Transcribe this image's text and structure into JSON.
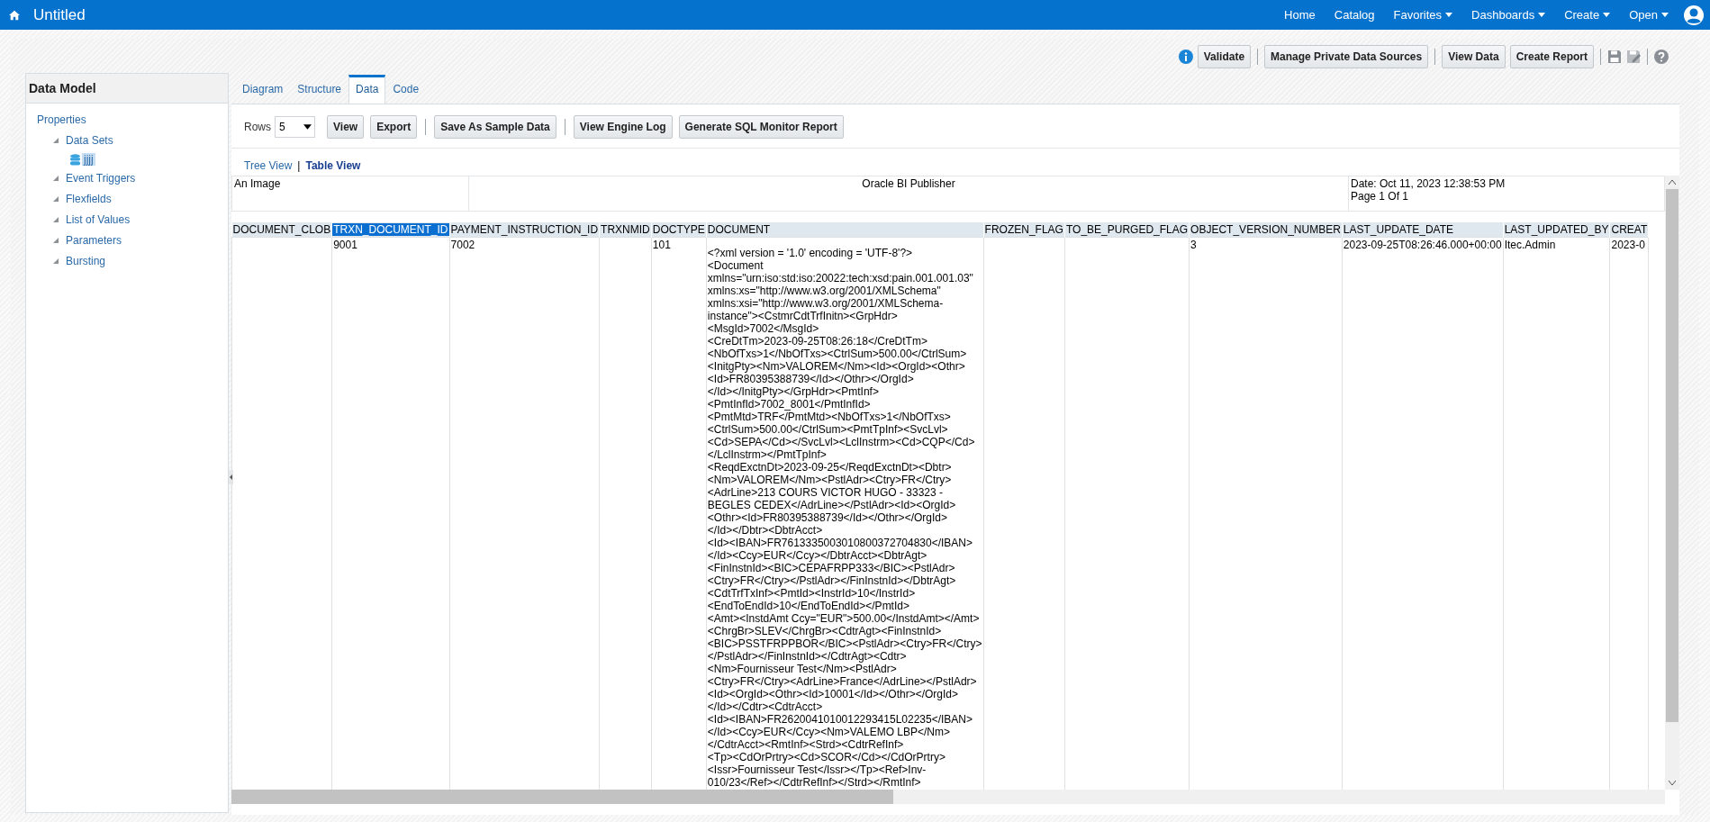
{
  "header": {
    "title": "Untitled",
    "nav": [
      {
        "label": "Home",
        "dropdown": false
      },
      {
        "label": "Catalog",
        "dropdown": false
      },
      {
        "label": "Favorites",
        "dropdown": true
      },
      {
        "label": "Dashboards",
        "dropdown": true
      },
      {
        "label": "Create",
        "dropdown": true
      },
      {
        "label": "Open",
        "dropdown": true
      }
    ]
  },
  "toolbar": {
    "buttons": [
      {
        "label": "Validate",
        "separator_after": true
      },
      {
        "label": "Manage Private Data Sources",
        "separator_after": true
      },
      {
        "label": "View Data",
        "separator_after": false
      },
      {
        "label": "Create Report",
        "separator_after": true
      }
    ]
  },
  "data_model": {
    "title": "Data Model",
    "tree": [
      {
        "label": "Properties",
        "children": [
          {
            "label": "Data Sets",
            "expanded": true,
            "children": [
              {
                "label": "jjjj",
                "selected": true
              }
            ]
          },
          {
            "label": "Event Triggers",
            "expanded": true
          },
          {
            "label": "Flexfields",
            "expanded": true
          },
          {
            "label": "List of Values",
            "expanded": true
          },
          {
            "label": "Parameters",
            "expanded": true
          },
          {
            "label": "Bursting",
            "expanded": true
          }
        ]
      }
    ]
  },
  "tabs": [
    {
      "label": "Diagram",
      "selected": false
    },
    {
      "label": "Structure",
      "selected": false
    },
    {
      "label": "Data",
      "selected": true
    },
    {
      "label": "Code",
      "selected": false
    }
  ],
  "rows_control": {
    "label": "Rows",
    "value": "5"
  },
  "data_buttons": [
    {
      "label": "View",
      "separator_after": false
    },
    {
      "label": "Export",
      "separator_after": true
    },
    {
      "label": "Save As Sample Data",
      "separator_after": true
    },
    {
      "label": "View Engine Log",
      "separator_after": false
    },
    {
      "label": "Generate SQL Monitor Report",
      "separator_after": false
    }
  ],
  "view_links": [
    {
      "label": "Tree View",
      "selected": false
    },
    {
      "label": "Table View",
      "selected": true
    }
  ],
  "view_separator": "|",
  "report_header": {
    "left": "An Image",
    "center": "Oracle BI Publisher",
    "date": "Date: Oct 11, 2023 12:38:53 PM",
    "page": "Page 1 Of 1"
  },
  "table": {
    "columns": [
      {
        "label": "DOCUMENT_CLOB",
        "selected": false
      },
      {
        "label": "TRXN_DOCUMENT_ID",
        "selected": true
      },
      {
        "label": "PAYMENT_INSTRUCTION_ID",
        "selected": false
      },
      {
        "label": "TRXNMID",
        "selected": false
      },
      {
        "label": "DOCTYPE",
        "selected": false
      },
      {
        "label": "DOCUMENT",
        "selected": false
      },
      {
        "label": "FROZEN_FLAG",
        "selected": false
      },
      {
        "label": "TO_BE_PURGED_FLAG",
        "selected": false
      },
      {
        "label": "OBJECT_VERSION_NUMBER",
        "selected": false
      },
      {
        "label": "LAST_UPDATE_DATE",
        "selected": false
      },
      {
        "label": "LAST_UPDATED_BY",
        "selected": false
      },
      {
        "label": "CREAT",
        "selected": false
      }
    ],
    "rows": [
      [
        "",
        "9001",
        "7002",
        "",
        "101",
        "<?xml version = '1.0' encoding = 'UTF-8'?>\n<Document\nxmlns=\"urn:iso:std:iso:20022:tech:xsd:pain.001.001.03\"\nxmlns:xs=\"http://www.w3.org/2001/XMLSchema\"\nxmlns:xsi=\"http://www.w3.org/2001/XMLSchema-\ninstance\"><CstmrCdtTrfInitn><GrpHdr>\n<MsgId>7002</MsgId>\n<CreDtTm>2023-09-25T08:26:18</CreDtTm>\n<NbOfTxs>1</NbOfTxs><CtrlSum>500.00</CtrlSum>\n<InitgPty><Nm>VALOREM</Nm><Id><OrgId><Othr>\n<Id>FR80395388739</Id></Othr></OrgId>\n</Id></InitgPty></GrpHdr><PmtInf>\n<PmtInfId>7002_8001</PmtInfId>\n<PmtMtd>TRF</PmtMtd><NbOfTxs>1</NbOfTxs>\n<CtrlSum>500.00</CtrlSum><PmtTpInf><SvcLvl>\n<Cd>SEPA</Cd></SvcLvl><LclInstrm><Cd>CQP</Cd>\n</LclInstrm></PmtTpInf>\n<ReqdExctnDt>2023-09-25</ReqdExctnDt><Dbtr>\n<Nm>VALOREM</Nm><PstlAdr><Ctry>FR</Ctry>\n<AdrLine>213 COURS VICTOR HUGO - 33323 -\nBEGLES CEDEX</AdrLine></PstlAdr><Id><OrgId>\n<Othr><Id>FR80395388739</Id></Othr></OrgId>\n</Id></Dbtr><DbtrAcct>\n<Id><IBAN>FR7613335003010800372704830</IBAN>\n</Id><Ccy>EUR</Ccy></DbtrAcct><DbtrAgt>\n<FinInstnId><BIC>CEPAFRPP333</BIC><PstlAdr>\n<Ctry>FR</Ctry></PstlAdr></FinInstnId></DbtrAgt>\n<CdtTrfTxInf><PmtId><InstrId>10</InstrId>\n<EndToEndId>10</EndToEndId></PmtId>\n<Amt><InstdAmt Ccy=\"EUR\">500.00</InstdAmt></Amt>\n<ChrgBr>SLEV</ChrgBr><CdtrAgt><FinInstnId>\n<BIC>PSSTFRPPBOR</BIC><PstlAdr><Ctry>FR</Ctry>\n</PstlAdr></FinInstnId></CdtrAgt><Cdtr>\n<Nm>Fournisseur Test</Nm><PstlAdr>\n<Ctry>FR</Ctry><AdrLine>France</AdrLine></PstlAdr>\n<Id><OrgId><Othr><Id>10001</Id></Othr></OrgId>\n</Id></Cdtr><CdtrAcct>\n<Id><IBAN>FR2620041010012293415L02235</IBAN>\n</Id><Ccy>EUR</Ccy><Nm>VALEMO LBP</Nm>\n</CdtrAcct><RmtInf><Strd><CdtrRefInf>\n<Tp><CdOrPrtry><Cd>SCOR</Cd></CdOrPrtry>\n<Issr>Fournisseur Test</Issr></Tp><Ref>Inv-\n010/23</Ref></CdtrRefInf></Strd></RmtInf>",
        "",
        "",
        "3",
        "2023-09-25T08:26:46.000+00:00",
        "Itec.Admin",
        "2023-0"
      ]
    ]
  }
}
